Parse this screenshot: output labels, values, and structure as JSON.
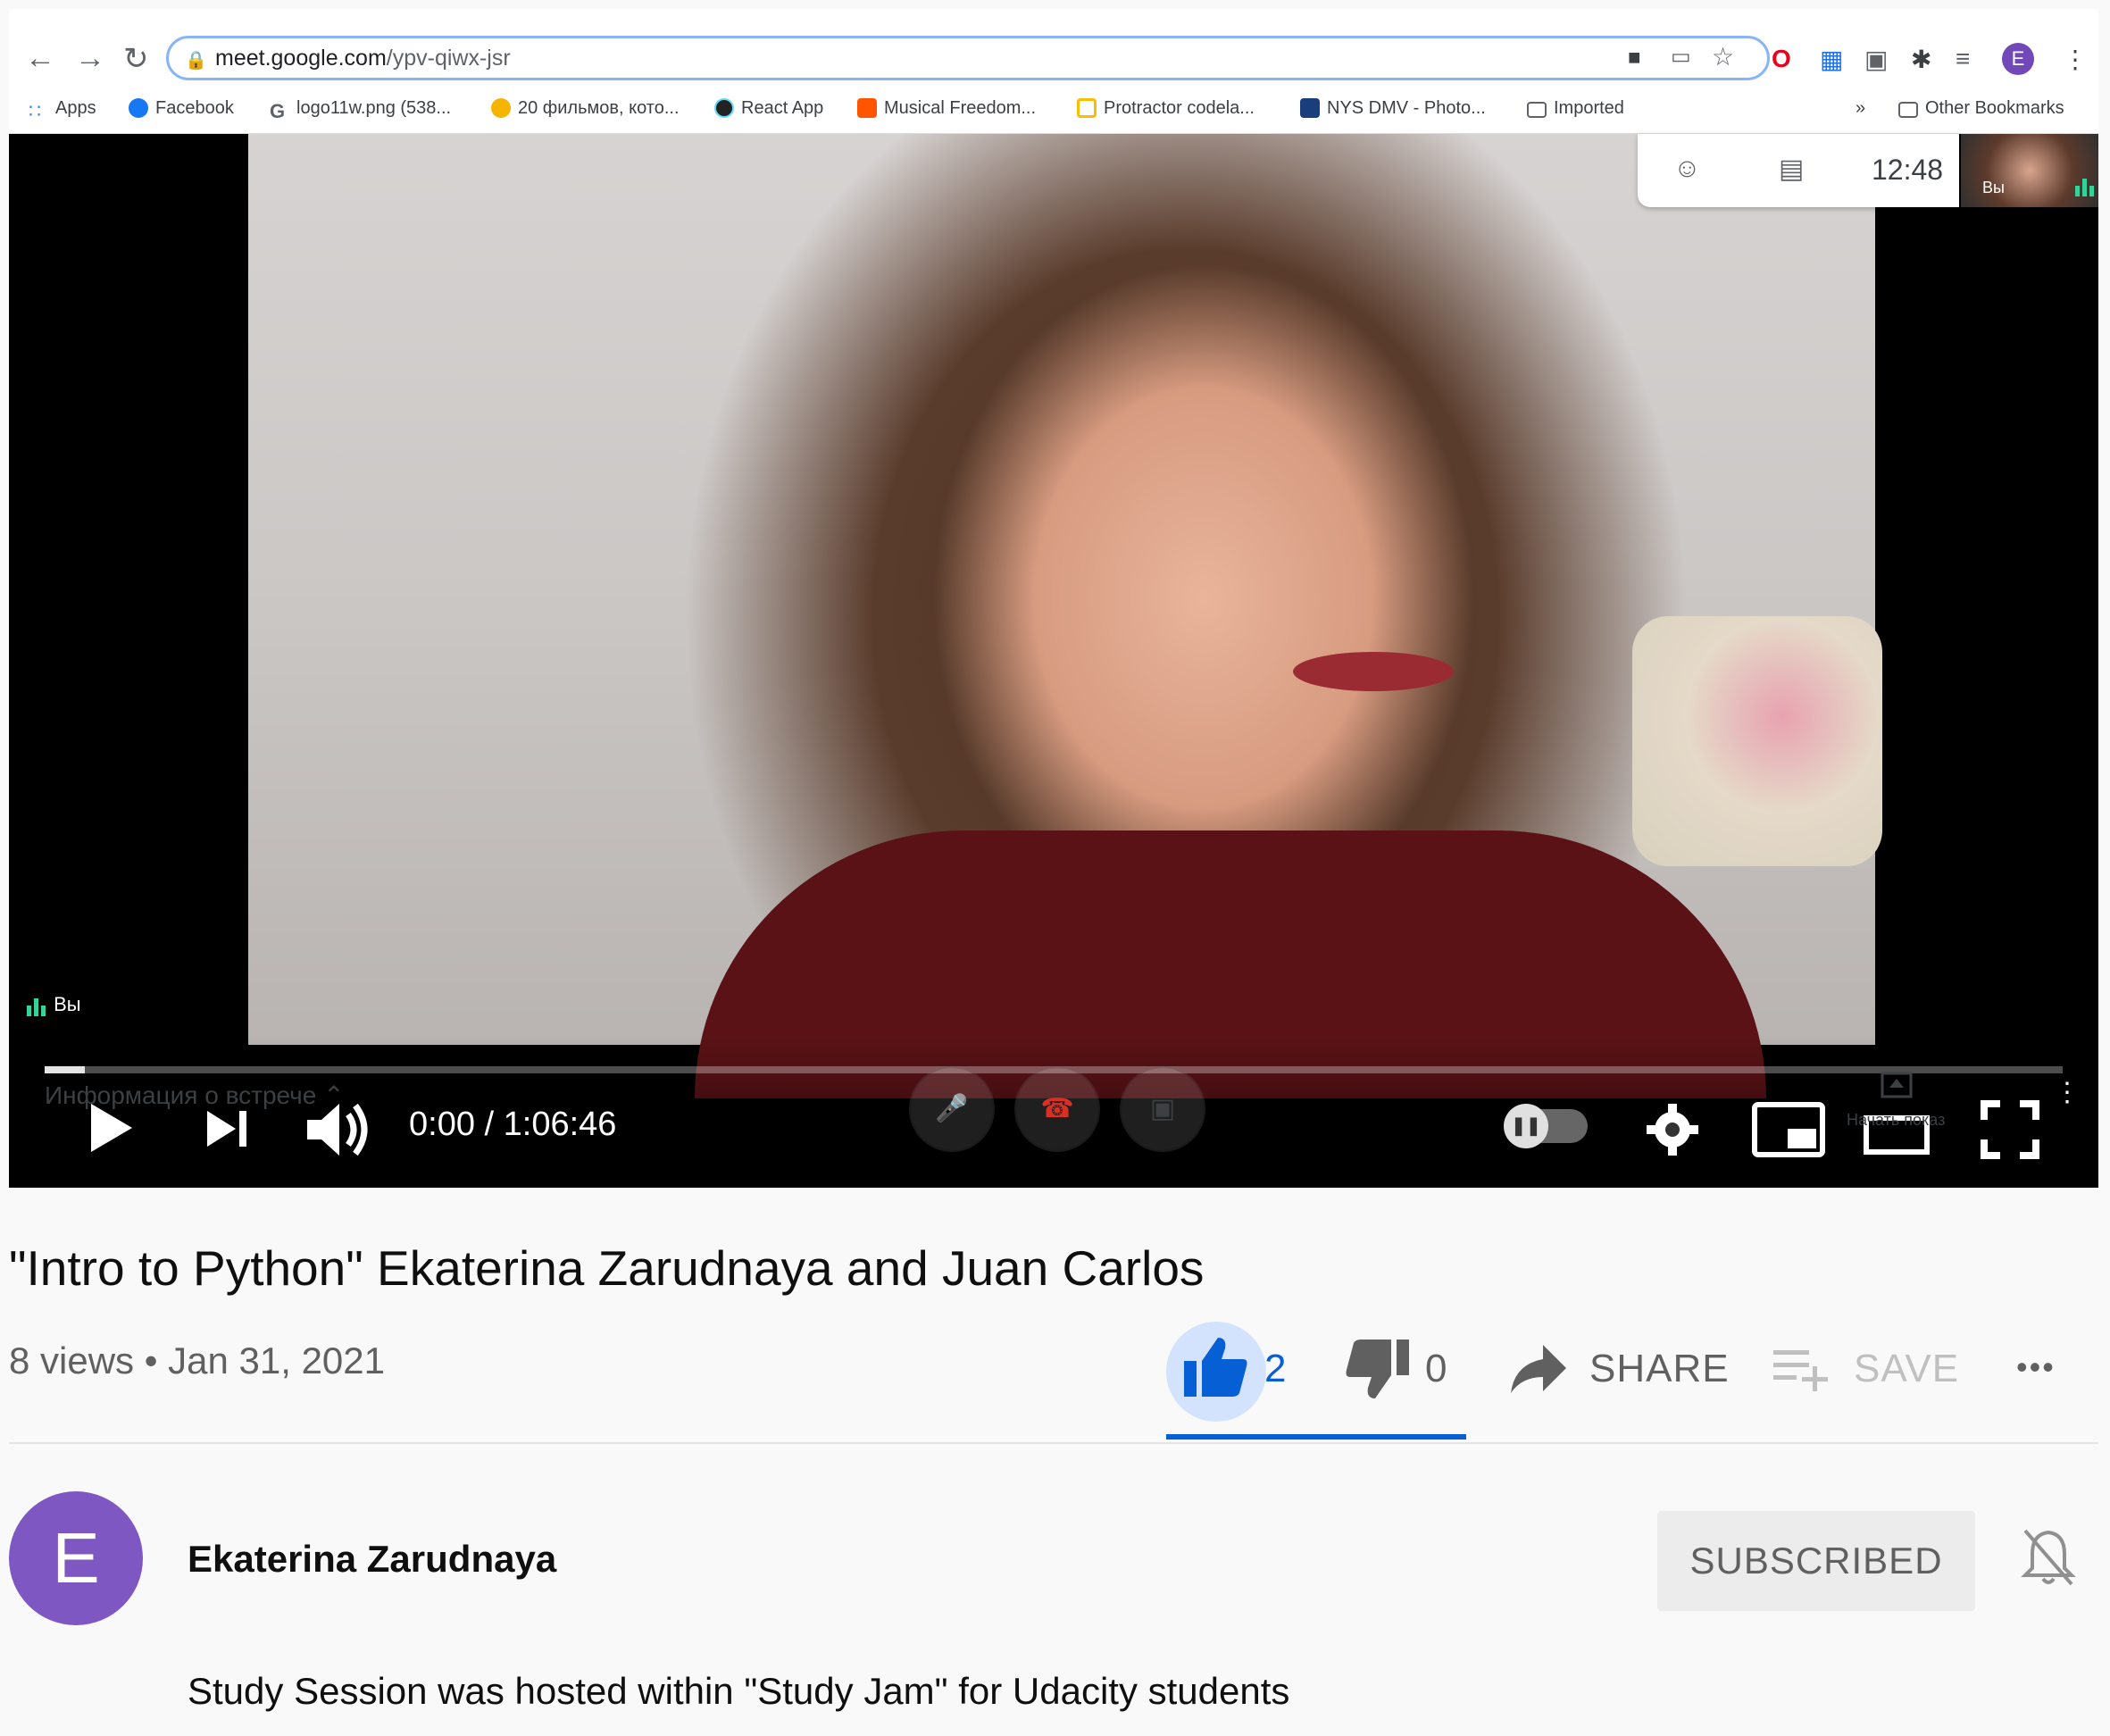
{
  "browser": {
    "url_host": "meet.google.com",
    "url_path": "/ypv-qiwx-jsr",
    "profile_initial": "E",
    "bookmarks": [
      {
        "label": "Apps",
        "icon": "apps-grid-icon",
        "color": "#4285f4"
      },
      {
        "label": "Facebook",
        "icon": "facebook-icon",
        "color": "#1877f2"
      },
      {
        "label": "logo11w.png (538...",
        "icon": "google-icon",
        "color": "#5f6368"
      },
      {
        "label": "20 фильмов, кото...",
        "icon": "site-icon",
        "color": "#f4b400"
      },
      {
        "label": "React App",
        "icon": "react-icon",
        "color": "#61dafb"
      },
      {
        "label": "Musical Freedom...",
        "icon": "soundcloud-icon",
        "color": "#ff5500"
      },
      {
        "label": "Protractor codela...",
        "icon": "site-icon",
        "color": "#fbbc04"
      },
      {
        "label": "NYS DMV - Photo...",
        "icon": "site-icon",
        "color": "#1a3d7c"
      },
      {
        "label": "Imported",
        "icon": "folder-icon",
        "color": "#5f6368"
      }
    ],
    "more_bookmarks": "»",
    "other_bookmarks": "Other Bookmarks"
  },
  "meet": {
    "time": "12:48",
    "self_label": "Вы",
    "you_label": "Вы",
    "meeting_info": "Информация о встрече",
    "present_label": "Начать показ"
  },
  "player": {
    "time_display": "0:00 / 1:06:46",
    "progress": 0.02
  },
  "video": {
    "title": "\"Intro to Python\" Ekaterina Zarudnaya and Juan Carlos",
    "views": "8 views",
    "date": "Jan 31, 2021",
    "likes": "2",
    "dislikes": "0",
    "share_label": "SHARE",
    "save_label": "SAVE",
    "more": "•••"
  },
  "channel": {
    "avatar_initial": "E",
    "avatar_color": "#7e57c2",
    "name": "Ekaterina Zarudnaya",
    "subscribe_label": "SUBSCRIBED",
    "description": "Study Session was hosted within \"Study Jam\" for Udacity students"
  },
  "colors": {
    "accent": "#065fd4",
    "like_bg": "#d3e3fd"
  }
}
